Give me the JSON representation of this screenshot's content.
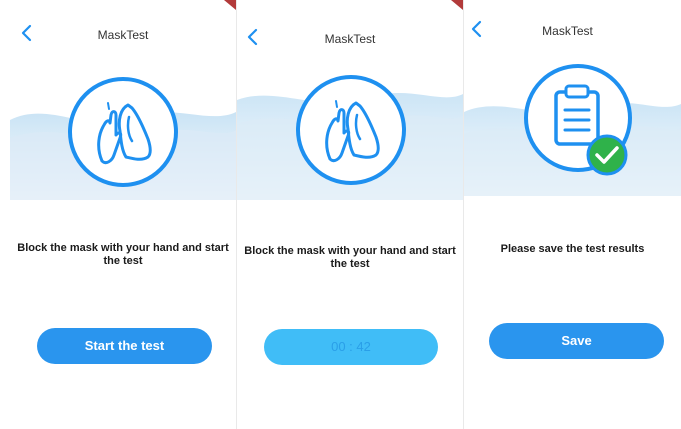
{
  "colors": {
    "accent": "#1e90f0",
    "button_primary": "#2a95ee",
    "button_timer": "#40bdf7",
    "timer_text": "#2a9fe8",
    "corner_mark": "#b23a3a"
  },
  "screens": [
    {
      "header": {
        "title": "MaskTest",
        "back_icon": "chevron-left-icon"
      },
      "icon": "lungs-hand-icon",
      "message": "Block the mask with your hand and start the test",
      "button_label": "Start the test"
    },
    {
      "header": {
        "title": "MaskTest",
        "back_icon": "chevron-left-icon"
      },
      "icon": "lungs-hand-icon",
      "message": "Block the mask with your hand and start the test",
      "timer_value": "00 : 42"
    },
    {
      "header": {
        "title": "MaskTest",
        "back_icon": "chevron-left-icon"
      },
      "icon": "clipboard-check-icon",
      "message": "Please save the test results",
      "button_label": "Save"
    }
  ]
}
